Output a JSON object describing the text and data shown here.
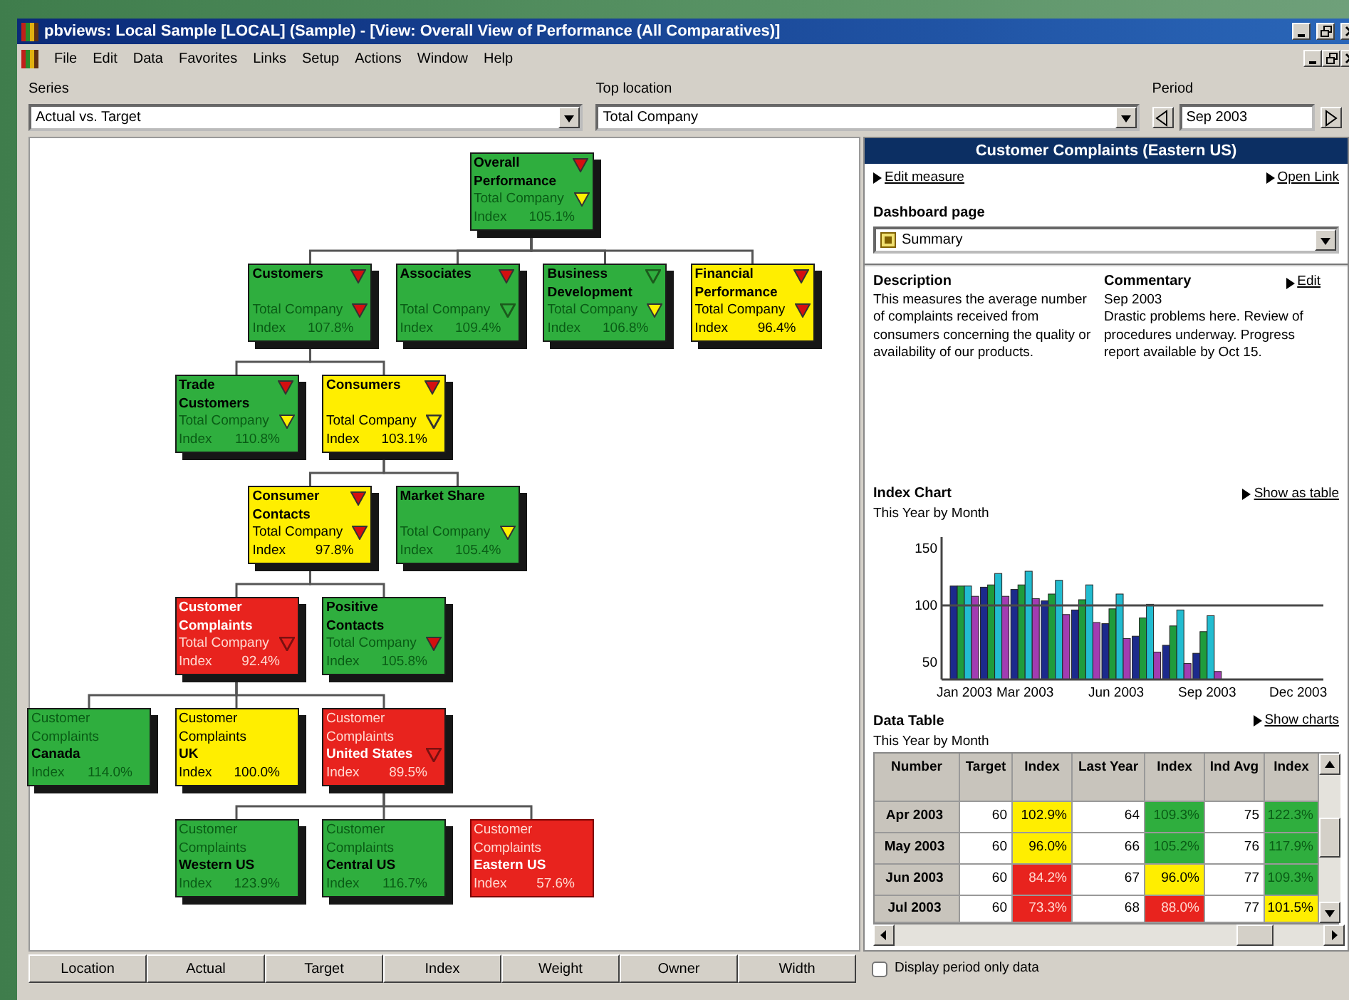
{
  "window": {
    "title": "pbviews: Local Sample [LOCAL] (Sample) - [View: Overall View of Performance (All Comparatives)]"
  },
  "menu": [
    "File",
    "Edit",
    "Data",
    "Favorites",
    "Links",
    "Setup",
    "Actions",
    "Window",
    "Help"
  ],
  "filters": {
    "series": {
      "label": "Series",
      "value": "Actual vs. Target"
    },
    "top_location": {
      "label": "Top location",
      "value": "Total Company"
    },
    "period": {
      "label": "Period",
      "value": "Sep 2003"
    }
  },
  "tree": {
    "kind": "measure",
    "name": "Overall Performance",
    "location": "Total Company",
    "index_label": "Index",
    "index": "105.1%",
    "color": "#2fae3e",
    "measure_flag": {
      "color": "#d41010",
      "filled": true
    },
    "location_flag": {
      "color": "#fff000",
      "filled": true
    },
    "selected": false,
    "children": [
      {
        "kind": "measure",
        "name": "Customers",
        "location": "Total Company",
        "index_label": "Index",
        "index": "107.8%",
        "color": "#2fae3e",
        "measure_flag": {
          "color": "#d41010",
          "filled": true
        },
        "location_flag": {
          "color": "#d41010",
          "filled": true
        },
        "selected": false,
        "children": [
          {
            "kind": "measure",
            "name": "Trade Customers",
            "location": "Total Company",
            "index_label": "Index",
            "index": "110.8%",
            "color": "#2fae3e",
            "measure_flag": {
              "color": "#d41010",
              "filled": true
            },
            "location_flag": {
              "color": "#fff000",
              "filled": true
            },
            "selected": false
          },
          {
            "kind": "measure",
            "name": "Consumers",
            "location": "Total Company",
            "index_label": "Index",
            "index": "103.1%",
            "color": "#ffee00",
            "measure_flag": {
              "color": "#d41010",
              "filled": true
            },
            "location_flag": {
              "color": "#333333",
              "filled": false
            },
            "selected": false,
            "children": [
              {
                "kind": "measure",
                "name": "Consumer Contacts",
                "location": "Total Company",
                "index_label": "Index",
                "index": "97.8%",
                "color": "#ffee00",
                "measure_flag": {
                  "color": "#d41010",
                  "filled": true
                },
                "location_flag": {
                  "color": "#d41010",
                  "filled": true
                },
                "selected": false,
                "children": [
                  {
                    "kind": "measure",
                    "name": "Customer Complaints",
                    "location": "Total Company",
                    "index_label": "Index",
                    "index": "92.4%",
                    "color": "#e8231e",
                    "location_flag": {
                      "color": "#7a1010",
                      "filled": false
                    },
                    "selected": false,
                    "children": [
                      {
                        "kind": "location",
                        "name": "Customer Complaints",
                        "location": "Canada",
                        "index_label": "Index",
                        "index": "114.0%",
                        "color": "#2fae3e",
                        "selected": false
                      },
                      {
                        "kind": "location",
                        "name": "Customer Complaints",
                        "location": "UK",
                        "index_label": "Index",
                        "index": "100.0%",
                        "color": "#ffee00",
                        "selected": false
                      },
                      {
                        "kind": "location",
                        "name": "Customer Complaints",
                        "location": "United States",
                        "index_label": "Index",
                        "index": "89.5%",
                        "color": "#e8231e",
                        "location_flag": {
                          "color": "#7a1010",
                          "filled": false
                        },
                        "selected": false,
                        "children": [
                          {
                            "kind": "location",
                            "name": "Customer Complaints",
                            "location": "Western US",
                            "index_label": "Index",
                            "index": "123.9%",
                            "color": "#2fae3e",
                            "selected": false
                          },
                          {
                            "kind": "location",
                            "name": "Customer Complaints",
                            "location": "Central US",
                            "index_label": "Index",
                            "index": "116.7%",
                            "color": "#2fae3e",
                            "selected": false
                          },
                          {
                            "kind": "location",
                            "name": "Customer Complaints",
                            "location": "Eastern US",
                            "index_label": "Index",
                            "index": "57.6%",
                            "color": "#e8231e",
                            "selected": true
                          }
                        ]
                      }
                    ]
                  },
                  {
                    "kind": "measure",
                    "name": "Positive Contacts",
                    "location": "Total Company",
                    "index_label": "Index",
                    "index": "105.8%",
                    "color": "#2fae3e",
                    "location_flag": {
                      "color": "#d41010",
                      "filled": true
                    },
                    "selected": false
                  }
                ]
              },
              {
                "kind": "measure",
                "name": "Market Share",
                "location": "Total Company",
                "index_label": "Index",
                "index": "105.4%",
                "color": "#2fae3e",
                "location_flag": {
                  "color": "#fff000",
                  "filled": true
                },
                "selected": false
              }
            ]
          }
        ]
      },
      {
        "kind": "measure",
        "name": "Associates",
        "location": "Total Company",
        "index_label": "Index",
        "index": "109.4%",
        "color": "#2fae3e",
        "measure_flag": {
          "color": "#d41010",
          "filled": true
        },
        "location_flag": {
          "color": "#1c5a1c",
          "filled": false
        },
        "selected": false
      },
      {
        "kind": "measure",
        "name": "Business Development",
        "location": "Total Company",
        "index_label": "Index",
        "index": "106.8%",
        "color": "#2fae3e",
        "measure_flag": {
          "color": "#1c5a1c",
          "filled": false
        },
        "location_flag": {
          "color": "#fff000",
          "filled": true
        },
        "selected": false
      },
      {
        "kind": "measure",
        "name": "Financial Performance",
        "location": "Total Company",
        "index_label": "Index",
        "index": "96.4%",
        "color": "#ffee00",
        "measure_flag": {
          "color": "#d41010",
          "filled": true
        },
        "location_flag": {
          "color": "#d41010",
          "filled": true
        },
        "selected": false
      }
    ]
  },
  "columns_bar": [
    "Location",
    "Actual",
    "Target",
    "Index",
    "Weight",
    "Owner",
    "Width"
  ],
  "detail": {
    "title": "Customer Complaints (Eastern US)",
    "links": [
      "Edit measure",
      "Open Link"
    ],
    "dashboard": {
      "label": "Dashboard page",
      "value": "Summary"
    },
    "description": {
      "heading": "Description",
      "text": "This measures the average number of complaints received from consumers concerning the quality or availability of our products."
    },
    "commentary": {
      "heading": "Commentary",
      "edit_link": "Edit",
      "date": "Sep 2003",
      "text": "Drastic problems here. Review of procedures underway. Progress report available by Oct 15."
    },
    "index_chart": {
      "heading": "Index Chart",
      "subtitle": "This Year by Month",
      "link": "Show as table",
      "chart_data": {
        "type": "bar",
        "categories": [
          "Jan 2003",
          null,
          "Mar 2003",
          null,
          null,
          "Jun 2003",
          null,
          null,
          "Sep 2003",
          null,
          null,
          "Dec 2003"
        ],
        "ylim": [
          35,
          160
        ],
        "yticks": [
          50,
          {
            "value": 100,
            "label": "100"
          },
          150
        ],
        "series": [
          {
            "color": "#1c2a8c",
            "values": [
              117,
              116,
              114,
              104,
              96,
              84,
              73,
              65,
              58,
              null,
              null,
              null
            ]
          },
          {
            "color": "#1f9c3c",
            "values": [
              117,
              118,
              118,
              110,
              105,
              97,
              89,
              82,
              77,
              null,
              null,
              null
            ]
          },
          {
            "color": "#22bcd0",
            "values": [
              117,
              128,
              130,
              122,
              118,
              110,
              101,
              96,
              91,
              null,
              null,
              null
            ]
          },
          {
            "color": "#a23cb2",
            "values": [
              108,
              108,
              106,
              92,
              85,
              71,
              59,
              49,
              42,
              null,
              null,
              null
            ]
          }
        ]
      }
    },
    "data_table": {
      "heading": "Data Table",
      "subtitle": "This Year by Month",
      "link": "Show charts",
      "columns": [
        "Number",
        "Target",
        "Index",
        "Last Year",
        "Index",
        "Ind Avg",
        "Index"
      ],
      "rows": [
        {
          "cells": [
            {
              "text": "Apr 2003"
            },
            {
              "text": "60"
            },
            {
              "text": "102.9%",
              "color": "#ffee00"
            },
            {
              "text": "64"
            },
            {
              "text": "109.3%",
              "color": "#2fae3e"
            },
            {
              "text": "75"
            },
            {
              "text": "122.3%",
              "color": "#2fae3e"
            }
          ]
        },
        {
          "cells": [
            {
              "text": "May 2003"
            },
            {
              "text": "60"
            },
            {
              "text": "96.0%",
              "color": "#ffee00"
            },
            {
              "text": "66"
            },
            {
              "text": "105.2%",
              "color": "#2fae3e"
            },
            {
              "text": "76"
            },
            {
              "text": "117.9%",
              "color": "#2fae3e"
            }
          ]
        },
        {
          "cells": [
            {
              "text": "Jun 2003"
            },
            {
              "text": "60"
            },
            {
              "text": "84.2%",
              "color": "#e8231e"
            },
            {
              "text": "67"
            },
            {
              "text": "96.0%",
              "color": "#ffee00"
            },
            {
              "text": "77"
            },
            {
              "text": "109.3%",
              "color": "#2fae3e"
            }
          ]
        },
        {
          "cells": [
            {
              "text": "Jul 2003"
            },
            {
              "text": "60"
            },
            {
              "text": "73.3%",
              "color": "#e8231e"
            },
            {
              "text": "68"
            },
            {
              "text": "88.0%",
              "color": "#e8231e"
            },
            {
              "text": "77"
            },
            {
              "text": "101.5%",
              "color": "#ffee00"
            }
          ]
        }
      ]
    },
    "period_only": {
      "label": "Display period only data",
      "checked": false
    }
  }
}
